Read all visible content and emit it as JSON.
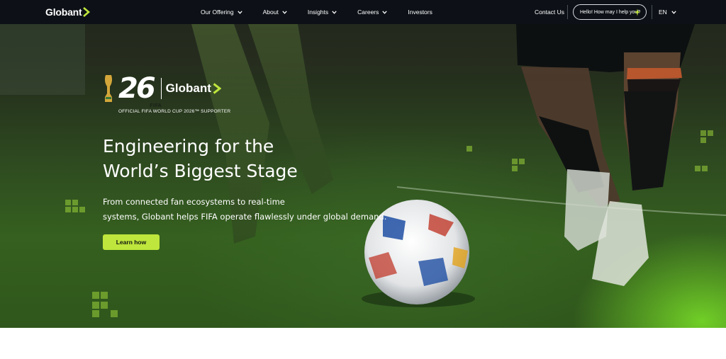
{
  "brand": {
    "name": "Globant",
    "accent_color": "#bfe63c"
  },
  "nav": {
    "items": [
      {
        "label": "Our Offering",
        "has_dropdown": true
      },
      {
        "label": "About",
        "has_dropdown": true
      },
      {
        "label": "Insights",
        "has_dropdown": true
      },
      {
        "label": "Careers",
        "has_dropdown": true
      },
      {
        "label": "Investors",
        "has_dropdown": false
      }
    ],
    "contact_label": "Contact Us",
    "chat_label": "Hello! How may I help you?",
    "language": "EN"
  },
  "hero": {
    "badge_number": "26",
    "badge_tag": "FIFA",
    "badge_brand": "Globant",
    "supporter_text": "OFFICIAL FIFA WORLD CUP 2026™ SUPPORTER",
    "headline_line1": "Engineering for the",
    "headline_line2": "World’s Biggest Stage",
    "sub_line1": "From connected fan ecosystems to real-time",
    "sub_line2": "systems, Globant helps FIFA operate flawlessly under global demand.",
    "cta_label": "Learn how"
  }
}
